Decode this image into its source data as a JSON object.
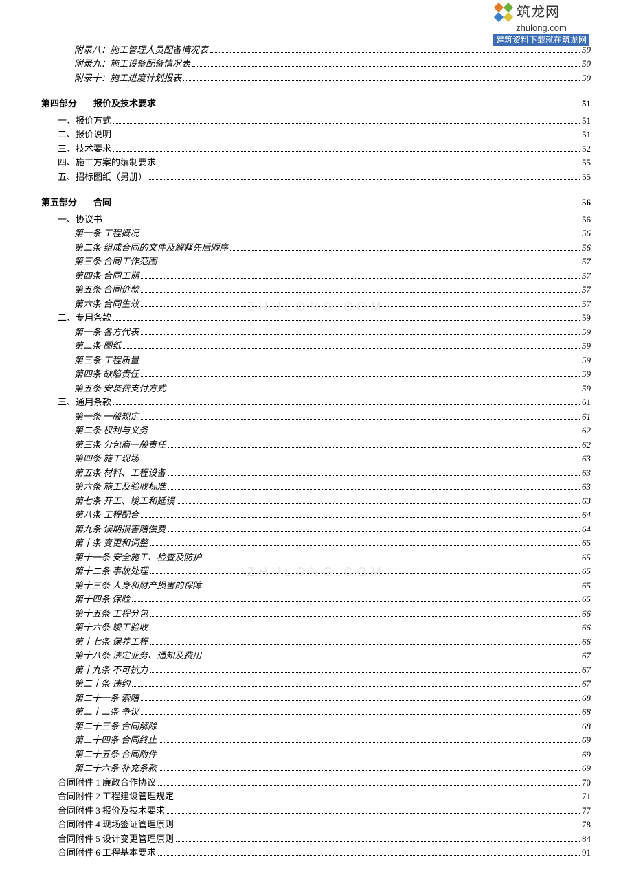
{
  "watermark": {
    "cn": "筑龙网",
    "en": "zhulong.com",
    "banner": "建筑资料下载就在筑龙网",
    "faint": "ZHULONG.COM"
  },
  "toc": [
    {
      "lvl": 2,
      "kai": true,
      "title": "附录八：施工管理人员配备情况表",
      "page": "50"
    },
    {
      "lvl": 2,
      "kai": true,
      "title": "附录九：施工设备配备情况表",
      "page": "50"
    },
    {
      "lvl": 2,
      "kai": true,
      "title": "附录十：施工进度计划报表",
      "page": "50"
    },
    {
      "lvl": 0,
      "section": true,
      "num": "第四部分",
      "title": "报价及技术要求",
      "page": "51"
    },
    {
      "lvl": 1,
      "title": "一、报价方式",
      "page": "51"
    },
    {
      "lvl": 1,
      "title": "二、报价说明",
      "page": "51"
    },
    {
      "lvl": 1,
      "title": "三、技术要求",
      "page": "52"
    },
    {
      "lvl": 1,
      "title": "四、施工方案的编制要求",
      "page": "55"
    },
    {
      "lvl": 1,
      "title": "五、招标图纸（另册）",
      "page": "55"
    },
    {
      "lvl": 0,
      "section": true,
      "num": "第五部分",
      "title": "合同",
      "page": "56"
    },
    {
      "lvl": 1,
      "title": "一、协议书",
      "page": "56"
    },
    {
      "lvl": 2,
      "kai": true,
      "title": "第一条 工程概况",
      "page": "56"
    },
    {
      "lvl": 2,
      "kai": true,
      "title": "第二条 组成合同的文件及解释先后顺序",
      "page": "56"
    },
    {
      "lvl": 2,
      "kai": true,
      "title": "第三条 合同工作范围",
      "page": "57"
    },
    {
      "lvl": 2,
      "kai": true,
      "title": "第四条 合同工期",
      "page": "57"
    },
    {
      "lvl": 2,
      "kai": true,
      "title": "第五条 合同价款",
      "page": "57"
    },
    {
      "lvl": 2,
      "kai": true,
      "title": "第六条 合同生效",
      "page": "57"
    },
    {
      "lvl": 1,
      "title": "二、专用条款",
      "page": "59"
    },
    {
      "lvl": 2,
      "kai": true,
      "title": "第一条 各方代表",
      "page": "59"
    },
    {
      "lvl": 2,
      "kai": true,
      "title": "第二条 图纸",
      "page": "59"
    },
    {
      "lvl": 2,
      "kai": true,
      "title": "第三条 工程质量",
      "page": "59"
    },
    {
      "lvl": 2,
      "kai": true,
      "title": "第四条 缺陷责任",
      "page": "59"
    },
    {
      "lvl": 2,
      "kai": true,
      "title": "第五条 安装费支付方式",
      "page": "59"
    },
    {
      "lvl": 1,
      "title": "三、通用条款",
      "page": "61"
    },
    {
      "lvl": 2,
      "kai": true,
      "title": "第一条 一般规定",
      "page": "61"
    },
    {
      "lvl": 2,
      "kai": true,
      "title": "第二条 权利与义务",
      "page": "62"
    },
    {
      "lvl": 2,
      "kai": true,
      "title": "第三条 分包商一般责任",
      "page": "62"
    },
    {
      "lvl": 2,
      "kai": true,
      "title": "第四条 施工现场",
      "page": "63"
    },
    {
      "lvl": 2,
      "kai": true,
      "title": "第五条 材料、工程设备",
      "page": "63"
    },
    {
      "lvl": 2,
      "kai": true,
      "title": "第六条 施工及验收标准",
      "page": "63"
    },
    {
      "lvl": 2,
      "kai": true,
      "title": "第七条 开工、竣工和延误",
      "page": "63"
    },
    {
      "lvl": 2,
      "kai": true,
      "title": "第八条 工程配合",
      "page": "64"
    },
    {
      "lvl": 2,
      "kai": true,
      "title": "第九条 误期损害赔偿费",
      "page": "64"
    },
    {
      "lvl": 2,
      "kai": true,
      "title": "第十条 变更和调整",
      "page": "65"
    },
    {
      "lvl": 2,
      "kai": true,
      "title": "第十一条 安全施工、检查及防护",
      "page": "65"
    },
    {
      "lvl": 2,
      "kai": true,
      "title": "第十二条 事故处理",
      "page": "65"
    },
    {
      "lvl": 2,
      "kai": true,
      "title": "第十三条 人身和财产损害的保障",
      "page": "65"
    },
    {
      "lvl": 2,
      "kai": true,
      "title": "第十四条 保险",
      "page": "65"
    },
    {
      "lvl": 2,
      "kai": true,
      "title": "第十五条 工程分包",
      "page": "66"
    },
    {
      "lvl": 2,
      "kai": true,
      "title": "第十六条 竣工验收",
      "page": "66"
    },
    {
      "lvl": 2,
      "kai": true,
      "title": "第十七条 保养工程",
      "page": "66"
    },
    {
      "lvl": 2,
      "kai": true,
      "title": "第十八条 法定业务、通知及费用",
      "page": "67"
    },
    {
      "lvl": 2,
      "kai": true,
      "title": "第十九条 不可抗力",
      "page": "67"
    },
    {
      "lvl": 2,
      "kai": true,
      "title": "第二十条 违约",
      "page": "67"
    },
    {
      "lvl": 2,
      "kai": true,
      "title": "第二十一条 索赔",
      "page": "68"
    },
    {
      "lvl": 2,
      "kai": true,
      "title": "第二十二条 争议",
      "page": "68"
    },
    {
      "lvl": 2,
      "kai": true,
      "title": "第二十三条 合同解除",
      "page": "68"
    },
    {
      "lvl": 2,
      "kai": true,
      "title": "第二十四条 合同终止",
      "page": "69"
    },
    {
      "lvl": 2,
      "kai": true,
      "title": "第二十五条 合同附件",
      "page": "69"
    },
    {
      "lvl": 2,
      "kai": true,
      "title": "第二十六条 补充条款",
      "page": "69"
    },
    {
      "lvl": 1,
      "title": "合同附件 1 廉政合作协议",
      "page": "70"
    },
    {
      "lvl": 1,
      "title": "合同附件 2 工程建设管理规定",
      "page": "71"
    },
    {
      "lvl": 1,
      "title": "合同附件 3 报价及技术要求",
      "page": "77"
    },
    {
      "lvl": 1,
      "title": "合同附件 4 现场签证管理原则",
      "page": "78"
    },
    {
      "lvl": 1,
      "title": "合同附件 5 设计变更管理原则",
      "page": "84"
    },
    {
      "lvl": 1,
      "title": "合同附件 6 工程基本要求",
      "page": "91"
    }
  ]
}
